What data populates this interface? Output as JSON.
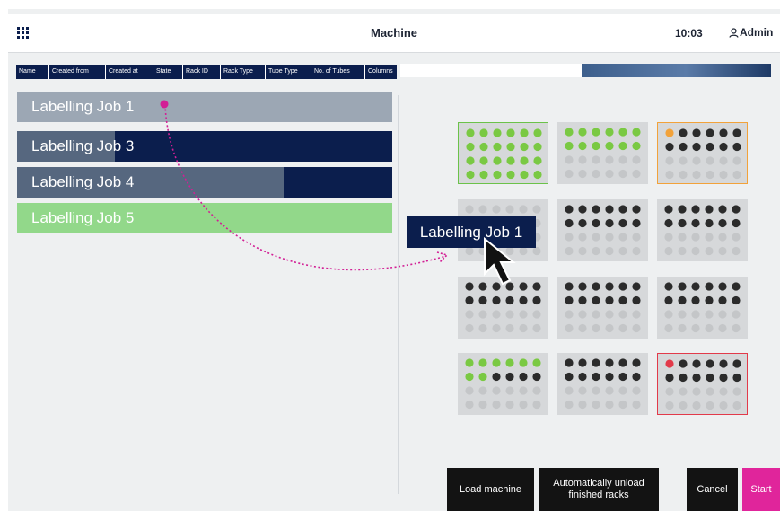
{
  "header": {
    "title": "Machine",
    "time": "10:03",
    "user": "Admin",
    "menu_icon": "grid-menu-icon",
    "user_icon": "user-icon"
  },
  "table": {
    "columns": [
      "Name",
      "Created from",
      "Created at",
      "State",
      "Rack ID",
      "Rack Type",
      "Tube Type",
      "No. of Tubes",
      "Columns"
    ]
  },
  "jobs": [
    {
      "label": "Labelling Job 1",
      "progress": 0
    },
    {
      "label": "Labelling Job 3",
      "progress": 0.26
    },
    {
      "label": "Labelling Job 4",
      "progress": 0.71
    },
    {
      "label": "Labelling Job 5",
      "progress": 1.0
    }
  ],
  "machine_progress": 0.51,
  "drag": {
    "label": "Labelling Job 1"
  },
  "racks": [
    {
      "border": "green",
      "rows": [
        "GGGGGG",
        "GGGGGG",
        "GGGGGG",
        "GGGGGG"
      ]
    },
    {
      "border": "none",
      "rows": [
        "GGGGGG",
        "GGGGGG",
        "eeeeee",
        "eeeeee"
      ]
    },
    {
      "border": "orange",
      "rows": [
        "ODDDDD",
        "DDDDDD",
        "eeeeee",
        "eeeeee"
      ]
    },
    {
      "border": "none",
      "rows": [
        "eeeeee",
        "eeeeee",
        "eeeeee",
        "eeeeee"
      ]
    },
    {
      "border": "none",
      "rows": [
        "DDDDDD",
        "DDDDDD",
        "eeeeee",
        "eeeeee"
      ]
    },
    {
      "border": "none",
      "rows": [
        "DDDDDD",
        "DDDDDD",
        "eeeeee",
        "eeeeee"
      ]
    },
    {
      "border": "none",
      "rows": [
        "DDDDDD",
        "DDDDDD",
        "eeeeee",
        "eeeeee"
      ]
    },
    {
      "border": "none",
      "rows": [
        "DDDDDD",
        "DDDDDD",
        "eeeeee",
        "eeeeee"
      ]
    },
    {
      "border": "none",
      "rows": [
        "DDDDDD",
        "DDDDDD",
        "eeeeee",
        "eeeeee"
      ]
    },
    {
      "border": "none",
      "rows": [
        "GGGGGG",
        "GGDDDD",
        "eeeeee",
        "eeeeee"
      ]
    },
    {
      "border": "none",
      "rows": [
        "DDDDDD",
        "DDDDDD",
        "eeeeee",
        "eeeeee"
      ]
    },
    {
      "border": "red",
      "rows": [
        "RDDDDD",
        "DDDDDD",
        "eeeeee",
        "eeeeee"
      ]
    }
  ],
  "buttons": {
    "load": "Load machine",
    "unload_line1": "Automatically unload",
    "unload_line2": "finished racks",
    "cancel": "Cancel",
    "start": "Start"
  },
  "colors": {
    "navy": "#0b1e4d",
    "green_tube": "#7ac943",
    "dark_tube": "#2b2b2b",
    "empty_tube": "#c4c6c8",
    "orange_tube": "#f2a23a",
    "red_tube": "#e23a4a",
    "accent_magenta": "#e0259b"
  }
}
